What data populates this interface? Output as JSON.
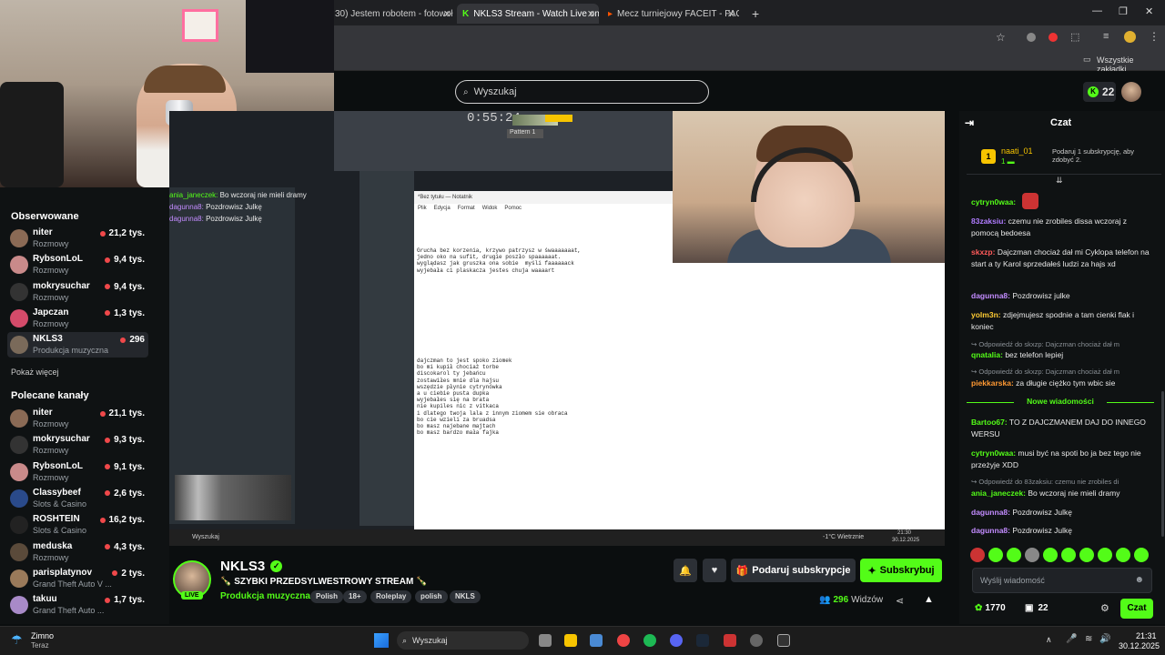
{
  "browser": {
    "tabs": [
      {
        "label": "30) Jestem robotem - fotowoł"
      },
      {
        "label": "NKLS3 Stream - Watch Live on"
      },
      {
        "label": "Mecz turniejowy FACEIT - FACE"
      }
    ],
    "bookmarks_label": "Wszystkie zakładki"
  },
  "header": {
    "search_placeholder": "Wyszukaj",
    "coins": "22"
  },
  "sidebar": {
    "followed_heading": "Obserwowane",
    "followed": [
      {
        "name": "niter",
        "category": "Rozmowy",
        "viewers": "21,2 tys.",
        "color": "#8a6a55"
      },
      {
        "name": "RybsonLoL",
        "category": "Rozmowy",
        "viewers": "9,4 tys.",
        "color": "#c98a8a"
      },
      {
        "name": "mokrysuchar",
        "category": "Rozmowy",
        "viewers": "9,4 tys.",
        "color": "#333333"
      },
      {
        "name": "Japczan",
        "category": "Rozmowy",
        "viewers": "1,3 tys.",
        "color": "#d44b6a"
      },
      {
        "name": "NKLS3",
        "category": "Produkcja muzyczna",
        "viewers": "296",
        "color": "#7a6a5a"
      }
    ],
    "show_more": "Pokaż więcej",
    "recommended_heading": "Polecane kanały",
    "recommended": [
      {
        "name": "niter",
        "category": "Rozmowy",
        "viewers": "21,1 tys.",
        "color": "#8a6a55"
      },
      {
        "name": "mokrysuchar",
        "category": "Rozmowy",
        "viewers": "9,3 tys.",
        "color": "#333333"
      },
      {
        "name": "RybsonLoL",
        "category": "Rozmowy",
        "viewers": "9,1 tys.",
        "color": "#c98a8a"
      },
      {
        "name": "Classybeef",
        "category": "Slots & Casino",
        "viewers": "2,6 tys.",
        "color": "#2a4a8a"
      },
      {
        "name": "ROSHTEIN",
        "category": "Slots & Casino",
        "viewers": "16,2 tys.",
        "color": "#222222"
      },
      {
        "name": "meduska",
        "category": "Rozmowy",
        "viewers": "4,3 tys.",
        "color": "#5a4a3a"
      },
      {
        "name": "parisplatynov",
        "category": "Grand Theft Auto V ...",
        "viewers": "2 tys.",
        "color": "#9a7a5a"
      },
      {
        "name": "takuu",
        "category": "Grand Theft Auto ...",
        "viewers": "1,7 tys.",
        "color": "#a88ac8"
      }
    ]
  },
  "stream_overlay": {
    "chat": [
      {
        "user": "ania_janeczek:",
        "text": "Bo wczoraj nie mieli dramy"
      },
      {
        "user": "dagunna8:",
        "text": "Pozdrowisz Julkę"
      },
      {
        "user": "dagunna8:",
        "text": "Pozdrowisz Julkę"
      }
    ],
    "notepad_title": "*Bez tytułu — Notatnik",
    "notepad_menu": [
      "Plik",
      "Edycja",
      "Format",
      "Widok",
      "Pomoc"
    ],
    "notepad_text_1": "Grucha bez korzenia, krzywo patrzysz w śwaaaaaaat,\njedno oko na sufit, drugie poszło spaaaaaat.\nwyglądasz jak gruszka ona sobie  myśli faaaaaack\nwyjebała ci plaskacza jestes chuja waaaart",
    "notepad_text_2": "dajczman to jest spoko ziomek\nbo mi kupił chociaż torbe\ndiscokarol ty jebańcu\nzostawiłes mnie dla hajsu\nwszędzie płynie cytrynówka\na u ciebie pusta dupka\nwyjebałes się na brata\nnie kupiles nic z vitkaca\ni dlatego twoja lala z innym ziomem sie obraca\nbo cie wzieli za bruadsa\nbo masz najebane majtach\nbo masz bardzo mała fajka",
    "daw_time": "0:55:24",
    "daw_pattern": "Pattern 1",
    "taskbar_search": "Wyszukaj",
    "taskbar_weather": "-1°C Wietrznie",
    "taskbar_time": "21:30",
    "taskbar_date": "30.12.2025"
  },
  "stream_info": {
    "name": "NKLS3",
    "live": "LIVE",
    "title": "🍾 SZYBKI PRZEDSYLWESTROWY STREAM 🍾",
    "category": "Produkcja muzyczna",
    "tags": [
      "Polish",
      "18+",
      "Roleplay",
      "polish",
      "NKLS"
    ],
    "gift_label": "Podaruj subskrypcje",
    "subscribe_label": "Subskrybuj",
    "viewers": "296",
    "viewers_label": "Widzów"
  },
  "chat": {
    "title": "Czat",
    "pinned_user": "naati_01",
    "pinned_rank": "1",
    "pinned_text": "Podaruj 1 subskrypcję, aby zdobyć 2.",
    "messages": [
      {
        "user": "cytryn0waa:",
        "text": "",
        "color": "#53fc18"
      },
      {
        "user": "83zaksiu:",
        "text": "czemu nie zrobiles dissa wczoraj z pomocą bedoesa",
        "color": "#b07cff"
      },
      {
        "user": "skxzp:",
        "text": "Dajczman chociaż dał mi Cyklopa telefon na start a ty Karol sprzedałeś ludzi za hajs xd",
        "color": "#ff5a5a"
      },
      {
        "user": "dagunna8:",
        "text": "Pozdrowisz julke",
        "color": "#c38cff"
      },
      {
        "user": "yolm3n:",
        "text": "zdjejmujesz spodnie a tam cienki flak i koniec",
        "color": "#ffcc33"
      },
      {
        "user": "qnatalia:",
        "text": "bez telefon lepiej",
        "color": "#53fc18"
      },
      {
        "user": "piekkarska:",
        "text": "za długie ciężko tym wbic sie",
        "color": "#ff9933"
      },
      {
        "user": "Bartoo67:",
        "text": "TO Z DAJCZMANEM DAJ DO INNEGO WERSU",
        "color": "#53fc18"
      },
      {
        "user": "cytryn0waa:",
        "text": "musi być na spoti bo ja bez tego nie przeżyje XDD",
        "color": "#53fc18"
      },
      {
        "user": "ania_janeczek:",
        "text": "Bo wczoraj nie mieli dramy",
        "color": "#53fc18"
      },
      {
        "user": "dagunna8:",
        "text": "Pozdrowisz Julkę",
        "color": "#c38cff"
      },
      {
        "user": "dagunna8:",
        "text": "Pozdrowisz Julkę",
        "color": "#c38cff"
      }
    ],
    "replies": [
      "Odpowiedź do skxzp: Dajczman chociaż dał m",
      "Odpowiedź do skxzp: Dajczman chociaż dał m",
      "Odpowiedź do 83zaksiu: czemu nie zrobiles di"
    ],
    "new_messages": "Nowe wiadomości",
    "input_placeholder": "Wyślij wiadomość",
    "points": "1770",
    "gifts": "22",
    "send_label": "Czat"
  },
  "taskbar": {
    "weather_temp": "Zimno",
    "weather_sub": "Teraz",
    "search": "Wyszukaj",
    "time": "21:31",
    "date": "30.12.2025"
  }
}
